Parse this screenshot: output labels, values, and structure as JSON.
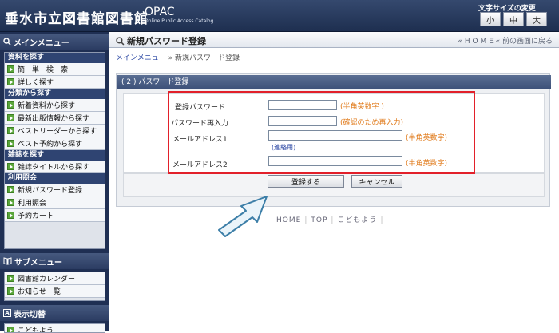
{
  "header": {
    "title": "垂水市立図書館図書館",
    "opac": "OPAC",
    "opac_sub": "Online Public Access Catalog",
    "font_size_label": "文字サイズの変更",
    "font_sizes": [
      "小",
      "中",
      "大"
    ]
  },
  "sidebar": {
    "main_menu_title": "メインメニュー",
    "categories": {
      "search": "資料を探す",
      "classify": "分類から探す",
      "magazine": "雑誌を探す",
      "usage": "利用照会"
    },
    "items": {
      "simple": "簡　単　検　索",
      "detail": "詳しく探す",
      "new": "新着資料から探す",
      "latest": "最新出版情報から探す",
      "bestreader": "ベストリーダーから探す",
      "bestreserve": "ベスト予約から探す",
      "magtitle": "雑誌タイトルから探す",
      "newpass": "新規パスワード登録",
      "inquiry": "利用照会",
      "cart": "予約カート"
    },
    "sub_menu_title": "サブメニュー",
    "sub_items": {
      "calendar": "図書館カレンダー",
      "notices": "お知らせ一覧"
    },
    "display_title": "表示切替",
    "display_item": "こどもよう"
  },
  "main": {
    "page_title": "新規パスワード登録",
    "top_links": "« H O M E   « 前の画面に戻る",
    "breadcrumb_link": "メインメニュー",
    "breadcrumb_sep": " » ",
    "breadcrumb_current": "新規パスワード登録",
    "section_title": "( 2 ) パスワード登録",
    "form": {
      "password_label": "登録パスワード",
      "password_note": "(半角英数字 )",
      "reenter_label": "パスワード再入力",
      "reenter_note": "(確認のため再入力)",
      "mail1_label": "メールアドレス1",
      "mail1_note": "(半角英数字)",
      "mail1_sub": "(連絡用)",
      "mail2_label": "メールアドレス2",
      "mail2_note": "(半角英数字)"
    },
    "submit_label": "登録する",
    "cancel_label": "キャンセル",
    "footer_links": [
      "HOME",
      "TOP",
      "こどもよう"
    ]
  }
}
